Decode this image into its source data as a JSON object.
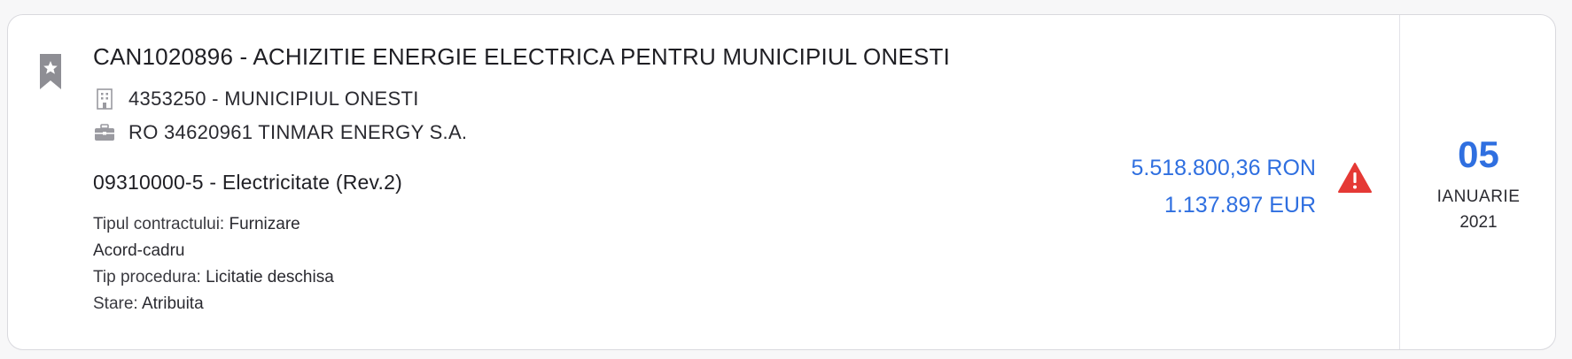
{
  "notice": {
    "title": "CAN1020896 - ACHIZITIE ENERGIE ELECTRICA PENTRU MUNICIPIUL ONESTI",
    "authority": "4353250 - MUNICIPIUL ONESTI",
    "supplier": "RO 34620961 TINMAR ENERGY S.A.",
    "cpv": "09310000-5 - Electricitate (Rev.2)",
    "details": [
      {
        "label": "Tipul contractului:",
        "value": "Furnizare"
      },
      {
        "label": "",
        "value": "Acord-cadru"
      },
      {
        "label": "Tip procedura:",
        "value": "Licitatie deschisa"
      },
      {
        "label": "Stare:",
        "value": "Atribuita"
      }
    ],
    "value_ron": "5.518.800,36 RON",
    "value_eur": "1.137.897 EUR",
    "date": {
      "day": "05",
      "month": "IANUARIE",
      "year": "2021"
    }
  },
  "icons": {
    "bookmark": "bookmark-star-icon",
    "authority": "building-icon",
    "supplier": "briefcase-icon",
    "warning": "warning-triangle-icon"
  },
  "colors": {
    "accent": "#2f6fe0",
    "warning": "#e53935",
    "icon_gray": "#9a9aa0"
  }
}
